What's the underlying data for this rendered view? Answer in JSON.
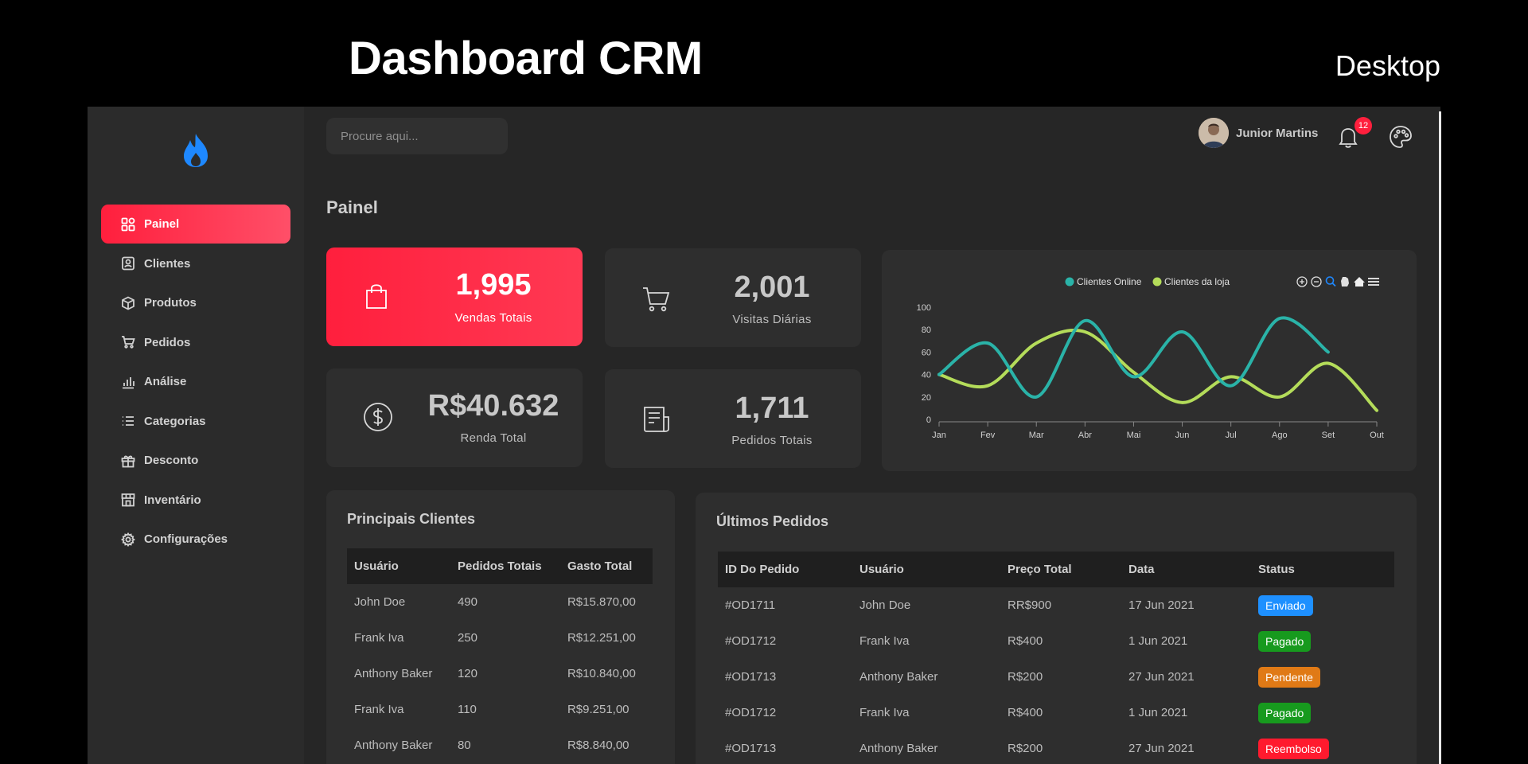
{
  "hero": {
    "title": "Dashboard CRM",
    "tag": "Desktop"
  },
  "search": {
    "placeholder": "Procure aqui..."
  },
  "user": {
    "name": "Junior Martins",
    "notifications": "12"
  },
  "page_title": "Painel",
  "sidebar": {
    "items": [
      {
        "label": "Painel",
        "icon": "grid-icon",
        "active": true
      },
      {
        "label": "Clientes",
        "icon": "contact-icon"
      },
      {
        "label": "Produtos",
        "icon": "box-icon"
      },
      {
        "label": "Pedidos",
        "icon": "cart-icon"
      },
      {
        "label": "Análise",
        "icon": "bar-chart-icon"
      },
      {
        "label": "Categorias",
        "icon": "list-icon"
      },
      {
        "label": "Desconto",
        "icon": "gift-icon"
      },
      {
        "label": "Inventário",
        "icon": "store-icon"
      },
      {
        "label": "Configurações",
        "icon": "gear-icon"
      }
    ]
  },
  "stats": [
    {
      "value": "1,995",
      "label": "Vendas Totais",
      "icon": "shopping-bag-icon"
    },
    {
      "value": "2,001",
      "label": "Visitas Diárias",
      "icon": "cart-icon"
    },
    {
      "value": "R$40.632",
      "label": "Renda Total",
      "icon": "dollar-icon"
    },
    {
      "value": "1,711",
      "label": "Pedidos Totais",
      "icon": "receipt-icon"
    }
  ],
  "colors": {
    "accent": "#ff1f3d",
    "series1": "#2ab3a8",
    "series2": "#b4dc5a",
    "enviado": "#1e90ff",
    "pagado": "#179a1e",
    "pendente": "#e07a16",
    "reembolso": "#ff1a2e"
  },
  "chart_data": {
    "type": "line",
    "categories": [
      "Jan",
      "Fev",
      "Mar",
      "Abr",
      "Mai",
      "Jun",
      "Jul",
      "Ago",
      "Set",
      "Out"
    ],
    "yticks": [
      0,
      20,
      40,
      60,
      80,
      100
    ],
    "ylim": [
      0,
      100
    ],
    "legend_position": "top",
    "series": [
      {
        "name": "Clientes Online",
        "values": [
          40,
          68,
          20,
          88,
          38,
          78,
          30,
          90,
          60,
          null
        ]
      },
      {
        "name": "Clientes da loja",
        "values": [
          40,
          30,
          68,
          78,
          42,
          15,
          38,
          20,
          50,
          8
        ]
      }
    ],
    "toolbar": [
      "zoom-in-icon",
      "zoom-out-icon",
      "magnify-icon",
      "pan-hand-icon",
      "home-icon",
      "menu-icon"
    ]
  },
  "top_customers": {
    "title": "Principais Clientes",
    "columns": [
      "Usuário",
      "Pedidos Totais",
      "Gasto Total"
    ],
    "rows": [
      [
        "John Doe",
        "490",
        "R$15.870,00"
      ],
      [
        "Frank Iva",
        "250",
        "R$12.251,00"
      ],
      [
        "Anthony Baker",
        "120",
        "R$10.840,00"
      ],
      [
        "Frank Iva",
        "110",
        "R$9.251,00"
      ],
      [
        "Anthony Baker",
        "80",
        "R$8.840,00"
      ]
    ]
  },
  "orders": {
    "title": "Últimos Pedidos",
    "columns": [
      "ID Do Pedido",
      "Usuário",
      "Preço Total",
      "Data",
      "Status"
    ],
    "rows": [
      {
        "id": "#OD1711",
        "user": "John Doe",
        "price": "RR$900",
        "date": "17 Jun 2021",
        "status": "Enviado",
        "status_color": "#1e90ff"
      },
      {
        "id": "#OD1712",
        "user": "Frank Iva",
        "price": "R$400",
        "date": "1 Jun 2021",
        "status": "Pagado",
        "status_color": "#179a1e"
      },
      {
        "id": "#OD1713",
        "user": "Anthony Baker",
        "price": "R$200",
        "date": "27 Jun 2021",
        "status": "Pendente",
        "status_color": "#e07a16"
      },
      {
        "id": "#OD1712",
        "user": "Frank Iva",
        "price": "R$400",
        "date": "1 Jun 2021",
        "status": "Pagado",
        "status_color": "#179a1e"
      },
      {
        "id": "#OD1713",
        "user": "Anthony Baker",
        "price": "R$200",
        "date": "27 Jun 2021",
        "status": "Reembolso",
        "status_color": "#ff1a2e"
      }
    ]
  }
}
